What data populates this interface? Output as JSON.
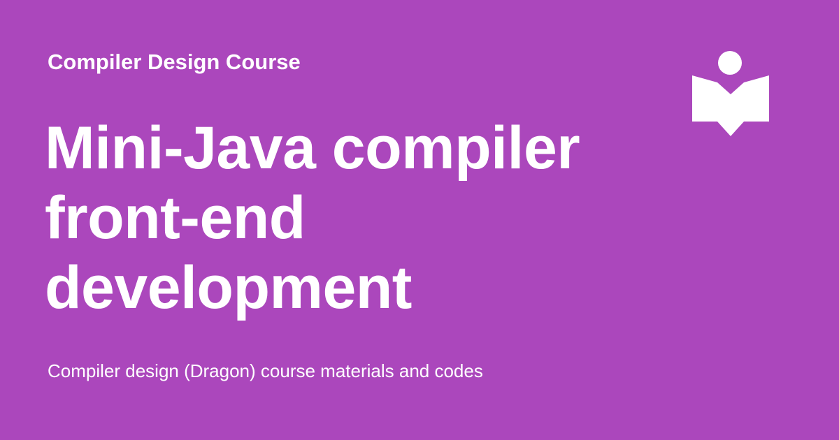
{
  "card": {
    "eyebrow": "Compiler Design Course",
    "title": "Mini-Java compiler front-end development",
    "subtitle": "Compiler design (Dragon) course materials and codes",
    "icon": "reader-book-icon",
    "colors": {
      "background": "#AB47BC",
      "text": "#FFFFFF"
    }
  }
}
